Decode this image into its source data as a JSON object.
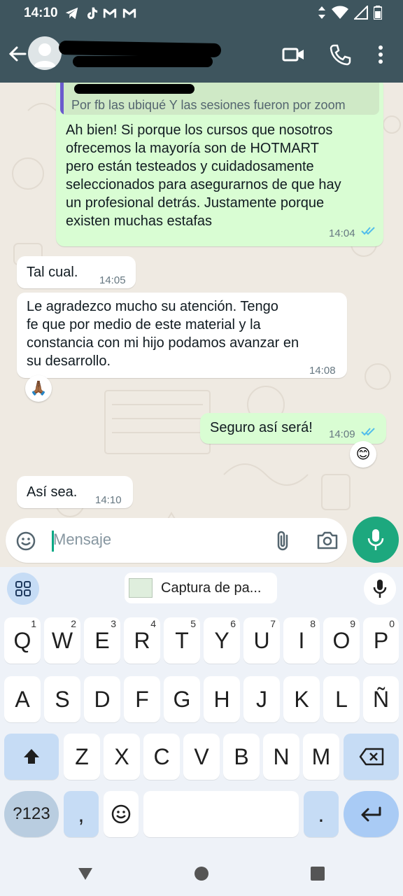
{
  "status_bar": {
    "time": "14:10",
    "notification_icons": [
      "telegram-icon",
      "tiktok-icon",
      "gmail-icon",
      "gmail-icon"
    ],
    "system_icons": [
      "data-arrows-icon",
      "wifi-icon",
      "signal-icon",
      "battery-icon"
    ]
  },
  "header": {
    "contact_name_redacted": true,
    "icons": [
      "back-arrow-icon",
      "video-call-icon",
      "phone-icon",
      "more-vert-icon"
    ]
  },
  "messages": [
    {
      "direction": "outgoing",
      "quote_text": "Por fb las ubiqué Y las sesiones fueron por zoom",
      "lines": [
        "Ah bien! Si porque los cursos que nosotros",
        "ofrecemos la mayoría son de HOTMART",
        "pero están testeados y cuidadosamente",
        "seleccionados para asegurarnos de que hay",
        "un profesional detrás. Justamente porque",
        "existen muchas estafas"
      ],
      "time": "14:04",
      "read": true
    },
    {
      "direction": "incoming",
      "lines": [
        "Tal cual."
      ],
      "time": "14:05"
    },
    {
      "direction": "incoming",
      "lines": [
        "Le agradezco mucho su atención. Tengo",
        "fe que por medio de este material y la",
        "constancia con mi hijo podamos avanzar en",
        "su desarrollo."
      ],
      "time": "14:08",
      "reaction": "🙏🏾"
    },
    {
      "direction": "outgoing",
      "lines": [
        "Seguro así será!"
      ],
      "time": "14:09",
      "read": true,
      "reaction": "😊"
    },
    {
      "direction": "incoming",
      "lines": [
        "Así sea."
      ],
      "time": "14:10"
    }
  ],
  "composer": {
    "placeholder": "Mensaje"
  },
  "keyboard": {
    "clipboard_chip": "Captura de pa...",
    "row1": [
      {
        "k": "Q",
        "n": "1"
      },
      {
        "k": "W",
        "n": "2"
      },
      {
        "k": "E",
        "n": "3"
      },
      {
        "k": "R",
        "n": "4"
      },
      {
        "k": "T",
        "n": "5"
      },
      {
        "k": "Y",
        "n": "6"
      },
      {
        "k": "U",
        "n": "7"
      },
      {
        "k": "I",
        "n": "8"
      },
      {
        "k": "O",
        "n": "9"
      },
      {
        "k": "P",
        "n": "0"
      }
    ],
    "row2": [
      "A",
      "S",
      "D",
      "F",
      "G",
      "H",
      "J",
      "K",
      "L",
      "Ñ"
    ],
    "row3": [
      "Z",
      "X",
      "C",
      "V",
      "B",
      "N",
      "M"
    ],
    "symbols_label": "?123",
    "comma": ",",
    "period": "."
  },
  "colors": {
    "header": "#3e555e",
    "outgoing_bubble": "#d9fdd3",
    "incoming_bubble": "#ffffff",
    "accent": "#1da87e",
    "read_ticks": "#53bdeb"
  }
}
